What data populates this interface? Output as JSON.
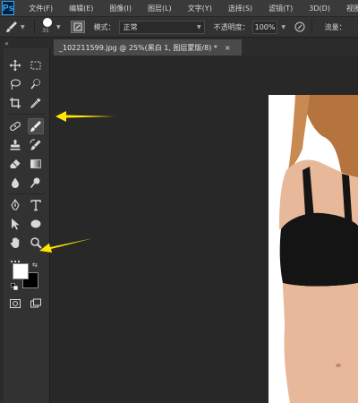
{
  "app": {
    "logo": "Ps",
    "menu": [
      "文件(F)",
      "编辑(E)",
      "图像(I)",
      "图层(L)",
      "文字(Y)",
      "选择(S)",
      "滤镜(T)",
      "3D(D)",
      "视图"
    ]
  },
  "options": {
    "brush_size": "35",
    "mode_label": "模式：",
    "mode_value": "正常",
    "opacity_label": "不透明度：",
    "opacity_value": "100%",
    "flow_label": "流量："
  },
  "document": {
    "tab_title": "_102211599.jpg @ 25%(黑白 1, 图层蒙版/8) *",
    "close": "×"
  },
  "toolbar": {
    "collapse": "«",
    "active_tool": "brush-tool",
    "foreground_color": "#ffffff",
    "background_color": "#000000"
  },
  "annotations": {
    "arrow_color": "#ffe600",
    "arrows": [
      "points-to-brush-tool",
      "points-to-color-swatches"
    ]
  },
  "colors": {
    "menubar": "#3a3a3a",
    "optbar": "#323232",
    "panel": "#323232",
    "canvas": "#282828",
    "skin": "#e8b89a",
    "hair": "#b5733e",
    "bra": "#141414"
  }
}
